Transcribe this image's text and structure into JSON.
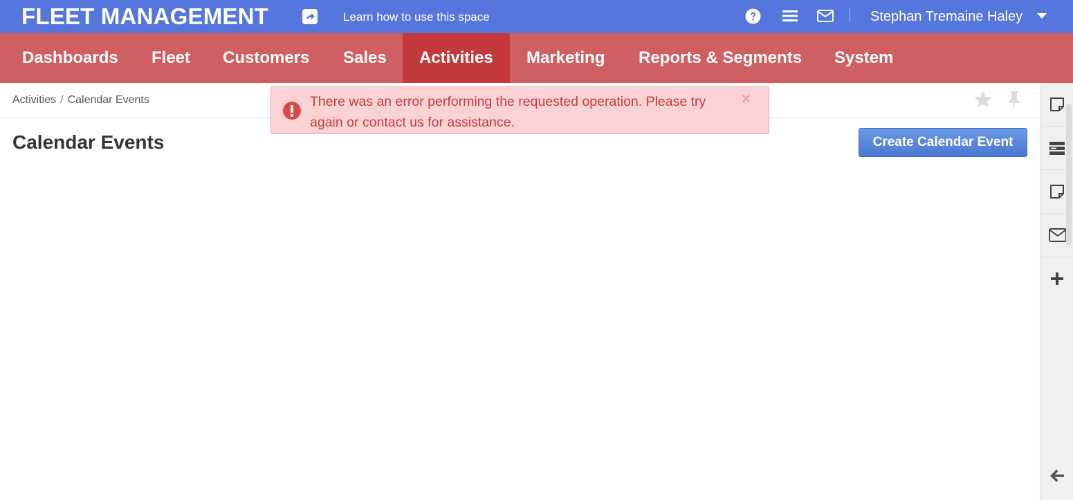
{
  "app": {
    "title": "FLEET MANAGEMENT",
    "learn_link": "Learn how to use this space"
  },
  "user": {
    "name": "Stephan Tremaine Haley"
  },
  "nav": {
    "items": [
      {
        "label": "Dashboards"
      },
      {
        "label": "Fleet"
      },
      {
        "label": "Customers"
      },
      {
        "label": "Sales"
      },
      {
        "label": "Activities"
      },
      {
        "label": "Marketing"
      },
      {
        "label": "Reports & Segments"
      },
      {
        "label": "System"
      }
    ],
    "active": "Activities"
  },
  "breadcrumb": {
    "parent": "Activities",
    "separator": "/",
    "current": "Calendar Events"
  },
  "page": {
    "title": "Calendar Events",
    "create_button": "Create Calendar Event"
  },
  "alert": {
    "message": "There was an error performing the requested operation. Please try again or contact us for assistance.",
    "close_symbol": "×"
  },
  "icons": {
    "topbar": [
      "share-icon",
      "help-icon",
      "menu-icon",
      "mail-icon",
      "caret-down-icon"
    ],
    "page_actions": [
      "star-icon",
      "pin-icon"
    ],
    "sidebar": [
      "note-icon",
      "tasks-icon",
      "note-icon",
      "mail-icon",
      "plus-icon",
      "arrow-left-icon"
    ]
  },
  "colors": {
    "topbar": "#5577dd",
    "nav": "#cf5f60",
    "nav_active": "#c43a3b",
    "alert_bg": "#fbd3d5",
    "alert_text": "#c33c3e",
    "primary_button": "#4a79d0"
  }
}
